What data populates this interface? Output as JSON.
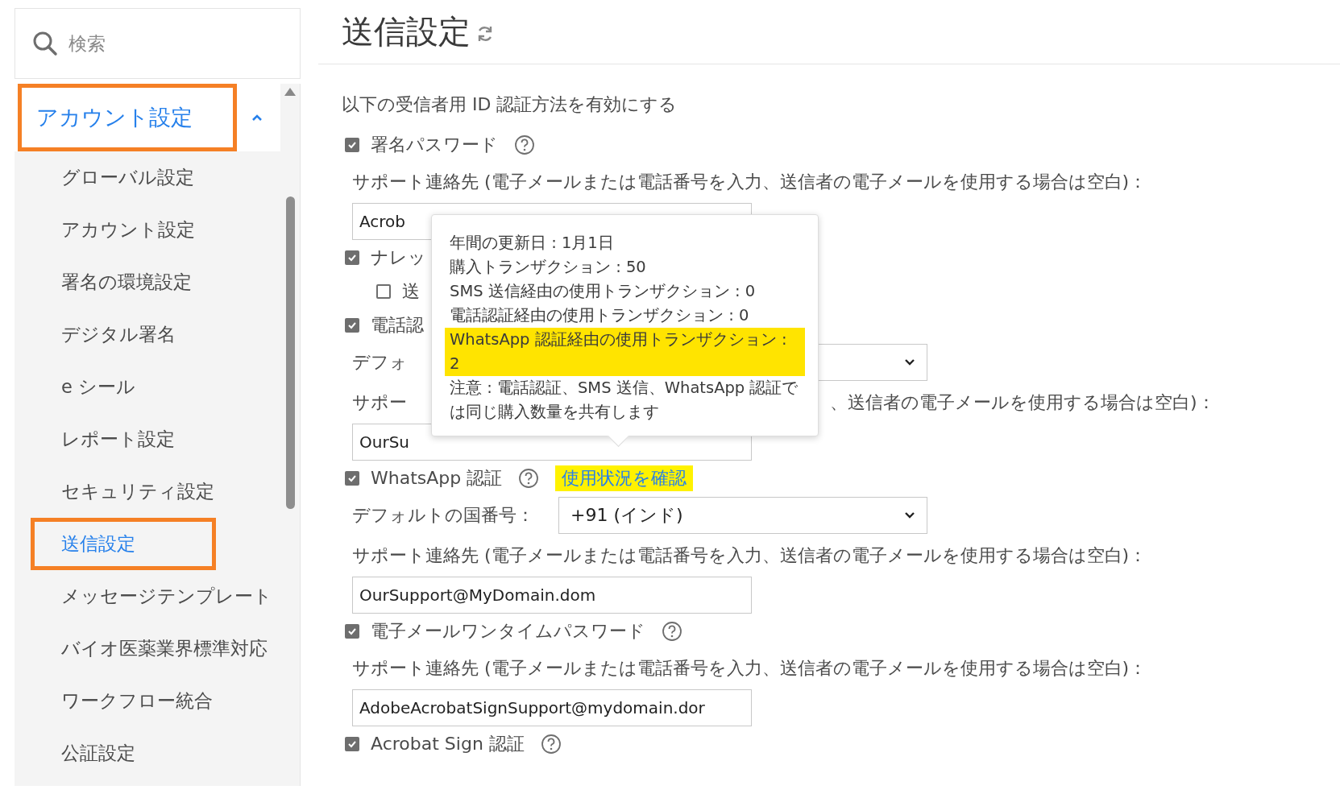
{
  "search": {
    "placeholder": "検索"
  },
  "sidebar": {
    "section": {
      "label": "アカウント設定",
      "expanded": true,
      "highlighted": true
    },
    "items": [
      {
        "label": "グローバル設定",
        "selected": false,
        "highlighted": false
      },
      {
        "label": "アカウント設定",
        "selected": false,
        "highlighted": false
      },
      {
        "label": "署名の環境設定",
        "selected": false,
        "highlighted": false
      },
      {
        "label": "デジタル署名",
        "selected": false,
        "highlighted": false
      },
      {
        "label": "e シール",
        "selected": false,
        "highlighted": false
      },
      {
        "label": "レポート設定",
        "selected": false,
        "highlighted": false
      },
      {
        "label": "セキュリティ設定",
        "selected": false,
        "highlighted": false
      },
      {
        "label": "送信設定",
        "selected": true,
        "highlighted": true
      },
      {
        "label": "メッセージテンプレート",
        "selected": false,
        "highlighted": false
      },
      {
        "label": "バイオ医薬業界標準対応",
        "selected": false,
        "highlighted": false
      },
      {
        "label": "ワークフロー統合",
        "selected": false,
        "highlighted": false
      },
      {
        "label": "公証設定",
        "selected": false,
        "highlighted": false
      }
    ]
  },
  "page": {
    "title": "送信設定"
  },
  "intro": "以下の受信者用 ID 認証方法を有効にする",
  "rows": [
    {
      "kind": "checkbox",
      "label": "署名パスワード",
      "checked": true,
      "help": true
    },
    {
      "kind": "label",
      "text": "サポート連絡先 (電子メールまたは電話番号を入力、送信者の電子メールを使用する場合は空白)："
    },
    {
      "kind": "input",
      "value": "Acrob"
    },
    {
      "kind": "checkbox",
      "label": "ナレッ",
      "checked": true,
      "help": false
    },
    {
      "kind": "subcheckbox",
      "label": "送",
      "checked": false
    },
    {
      "kind": "checkbox",
      "label": "電話認",
      "checked": true,
      "help": false
    },
    {
      "kind": "select",
      "label": "デフォ"
    },
    {
      "kind": "label",
      "text": "サポー",
      "text_2": "、送信者の電子メールを使用する場合は空白)："
    },
    {
      "kind": "input",
      "value": "OurSu"
    },
    {
      "kind": "checkbox",
      "label": "WhatsApp 認証",
      "checked": true,
      "help": true,
      "link": {
        "text": "使用状況を確認",
        "highlighted": true
      }
    },
    {
      "kind": "select",
      "label": "デフォルトの国番号：",
      "value": "+91 (インド)"
    },
    {
      "kind": "label",
      "text": "サポート連絡先 (電子メールまたは電話番号を入力、送信者の電子メールを使用する場合は空白)："
    },
    {
      "kind": "input",
      "value": "OurSupport@MyDomain.dom"
    },
    {
      "kind": "checkbox",
      "label": "電子メールワンタイムパスワード",
      "checked": true,
      "help": true
    },
    {
      "kind": "label",
      "text": "サポート連絡先 (電子メールまたは電話番号を入力、送信者の電子メールを使用する場合は空白)："
    },
    {
      "kind": "input",
      "value": "AdobeAcrobatSignSupport@mydomain.dor"
    },
    {
      "kind": "checkbox",
      "label": "Acrobat Sign 認証",
      "checked": true,
      "help": true
    }
  ],
  "tooltip": {
    "lines": [
      {
        "text": "年間の更新日 : 1月1日",
        "highlighted": false
      },
      {
        "text": "購入トランザクション : 50",
        "highlighted": false
      },
      {
        "text": "SMS 送信経由の使用トランザクション : 0",
        "highlighted": false
      },
      {
        "text": "電話認証経由の使用トランザクション : 0",
        "highlighted": false
      },
      {
        "text": "WhatsApp 認証経由の使用トランザクション : 2",
        "highlighted": true
      },
      {
        "text": "注意 : 電話認証、SMS 送信、WhatsApp 認証では同じ購入数量を共有します",
        "highlighted": false
      }
    ]
  }
}
